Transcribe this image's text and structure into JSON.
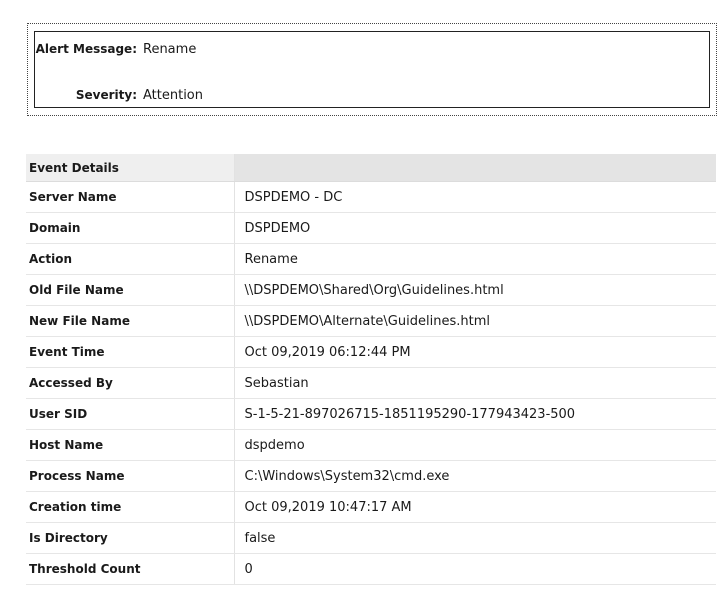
{
  "alert": {
    "message_label": "Alert Message:",
    "message_value": "Rename",
    "severity_label": "Severity:",
    "severity_value": "Attention"
  },
  "event_details": {
    "header": "Event Details",
    "rows": [
      {
        "key": "Server Name",
        "value": "DSPDEMO - DC"
      },
      {
        "key": "Domain",
        "value": "DSPDEMO"
      },
      {
        "key": "Action",
        "value": "Rename"
      },
      {
        "key": "Old File Name",
        "value": "\\\\DSPDEMO\\Shared\\Org\\Guidelines.html"
      },
      {
        "key": "New File Name",
        "value": "\\\\DSPDEMO\\Alternate\\Guidelines.html"
      },
      {
        "key": "Event Time",
        "value": "Oct 09,2019 06:12:44 PM"
      },
      {
        "key": "Accessed By",
        "value": "Sebastian"
      },
      {
        "key": "User SID",
        "value": "S-1-5-21-897026715-1851195290-177943423-500"
      },
      {
        "key": "Host Name",
        "value": "dspdemo"
      },
      {
        "key": "Process Name",
        "value": "C:\\Windows\\System32\\cmd.exe"
      },
      {
        "key": "Creation time",
        "value": "Oct 09,2019 10:47:17 AM"
      },
      {
        "key": "Is Directory",
        "value": "false"
      },
      {
        "key": "Threshold Count",
        "value": "0"
      }
    ]
  }
}
